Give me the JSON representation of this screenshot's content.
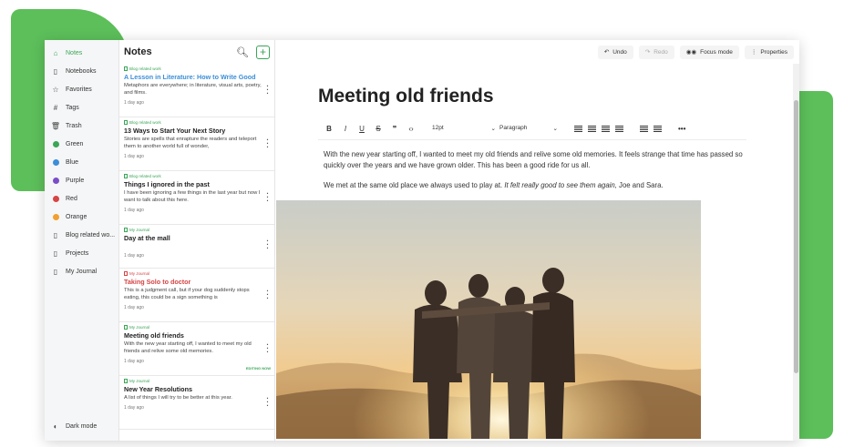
{
  "sidebar": {
    "items": [
      {
        "label": "Notes",
        "icon": "home-icon",
        "active": true
      },
      {
        "label": "Notebooks",
        "icon": "notebook-icon"
      },
      {
        "label": "Favorites",
        "icon": "star-icon"
      },
      {
        "label": "Tags",
        "icon": "hash-icon"
      },
      {
        "label": "Trash",
        "icon": "trash-icon"
      },
      {
        "label": "Green",
        "color": "#3aa657"
      },
      {
        "label": "Blue",
        "color": "#3b8ed8"
      },
      {
        "label": "Purple",
        "color": "#7a4ec7"
      },
      {
        "label": "Red",
        "color": "#d64545"
      },
      {
        "label": "Orange",
        "color": "#f0a030"
      },
      {
        "label": "Blog related wo...",
        "icon": "notebook-icon"
      },
      {
        "label": "Projects",
        "icon": "notebook-icon"
      },
      {
        "label": "My Journal",
        "icon": "notebook-icon"
      }
    ],
    "dark_mode_label": "Dark mode"
  },
  "notes_panel": {
    "title": "Notes",
    "notes": [
      {
        "tag": "Blog related work",
        "title": "A Lesson in Literature: How to Write Good",
        "excerpt": "Metaphors are everywhere; in literature, visual arts, poetry, and films.",
        "date": "1 day ago"
      },
      {
        "tag": "Blog related work",
        "title": "13 Ways to Start Your Next Story",
        "excerpt": "Stories are spells that enrapture the readers and teleport them to another world full of wonder,",
        "date": "1 day ago"
      },
      {
        "tag": "Blog related work",
        "title": "Things I ignored in the past",
        "excerpt": "I have been ignoring a few things in the last year but now I want to talk about this here.",
        "date": "1 day ago"
      },
      {
        "tag": "My Journal",
        "title": "Day at the mall",
        "excerpt": "",
        "date": "1 day ago"
      },
      {
        "tag": "My Journal",
        "title": "Taking Solo to doctor",
        "excerpt": "This is a judgment call, but if your dog suddenly stops eating, this could be a sign something is",
        "date": "1 day ago"
      },
      {
        "tag": "My Journal",
        "title": "Meeting old friends",
        "excerpt": "With the new year starting off, I wanted to meet my old friends and relive some old memories.",
        "date": "1 day ago",
        "badge": "EDITING NOW"
      },
      {
        "tag": "My Journal",
        "title": "New Year Resolutions",
        "excerpt": "A list of things I will try to be better at this year.",
        "date": "1 day ago"
      }
    ]
  },
  "topbar": {
    "undo": "Undo",
    "redo": "Redo",
    "focus_mode": "Focus mode",
    "properties": "Properties"
  },
  "editor": {
    "title": "Meeting old friends",
    "font_size": "12pt",
    "paragraph_style": "Paragraph",
    "para1": "With the new year starting off, I wanted to meet my old friends and relive some old memories. It feels strange that time has passed so quickly over the years and we have grown older. This has been a good ride for us all.",
    "para2_start": "We met at the same old place we always used to play at. ",
    "para2_italic": "It felt really good to see them again,",
    "para2_end": " Joe and Sara."
  },
  "colors": {
    "accent": "#3aa657",
    "brand_deco": "#5cbf5a"
  }
}
